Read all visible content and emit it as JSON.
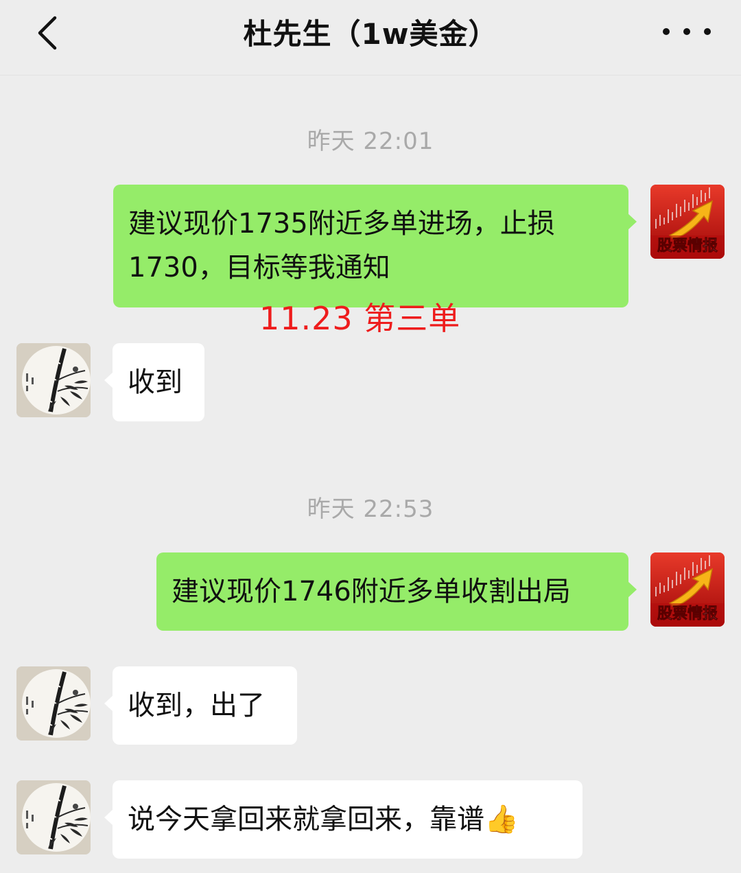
{
  "header": {
    "back_icon": "chevron-left-icon",
    "title": "杜先生（1w美金）",
    "more_icon": "more-horizontal-icon"
  },
  "messages": [
    {
      "type": "timestamp",
      "text": "昨天 22:01"
    },
    {
      "type": "outgoing",
      "sender_avatar": "股票情报",
      "text_line1": "建议现价1735附近多单进场，止损",
      "text_line2": "1730，目标等我通知"
    },
    {
      "type": "annotation",
      "text": "11.23  第三单",
      "color": "#ee1c1c"
    },
    {
      "type": "incoming",
      "text": "收到"
    },
    {
      "type": "timestamp",
      "text": "昨天 22:53"
    },
    {
      "type": "outgoing",
      "sender_avatar": "股票情报",
      "text": "建议现价1746附近多单收割出局"
    },
    {
      "type": "incoming",
      "text": "收到，出了"
    },
    {
      "type": "incoming",
      "text": "说今天拿回来就拿回来，靠谱",
      "emoji": "👍"
    }
  ],
  "colors": {
    "background": "#ededed",
    "outgoing_bubble": "#95ec69",
    "incoming_bubble": "#ffffff",
    "timestamp": "#a9a9a9",
    "stock_avatar": "#c81010"
  }
}
